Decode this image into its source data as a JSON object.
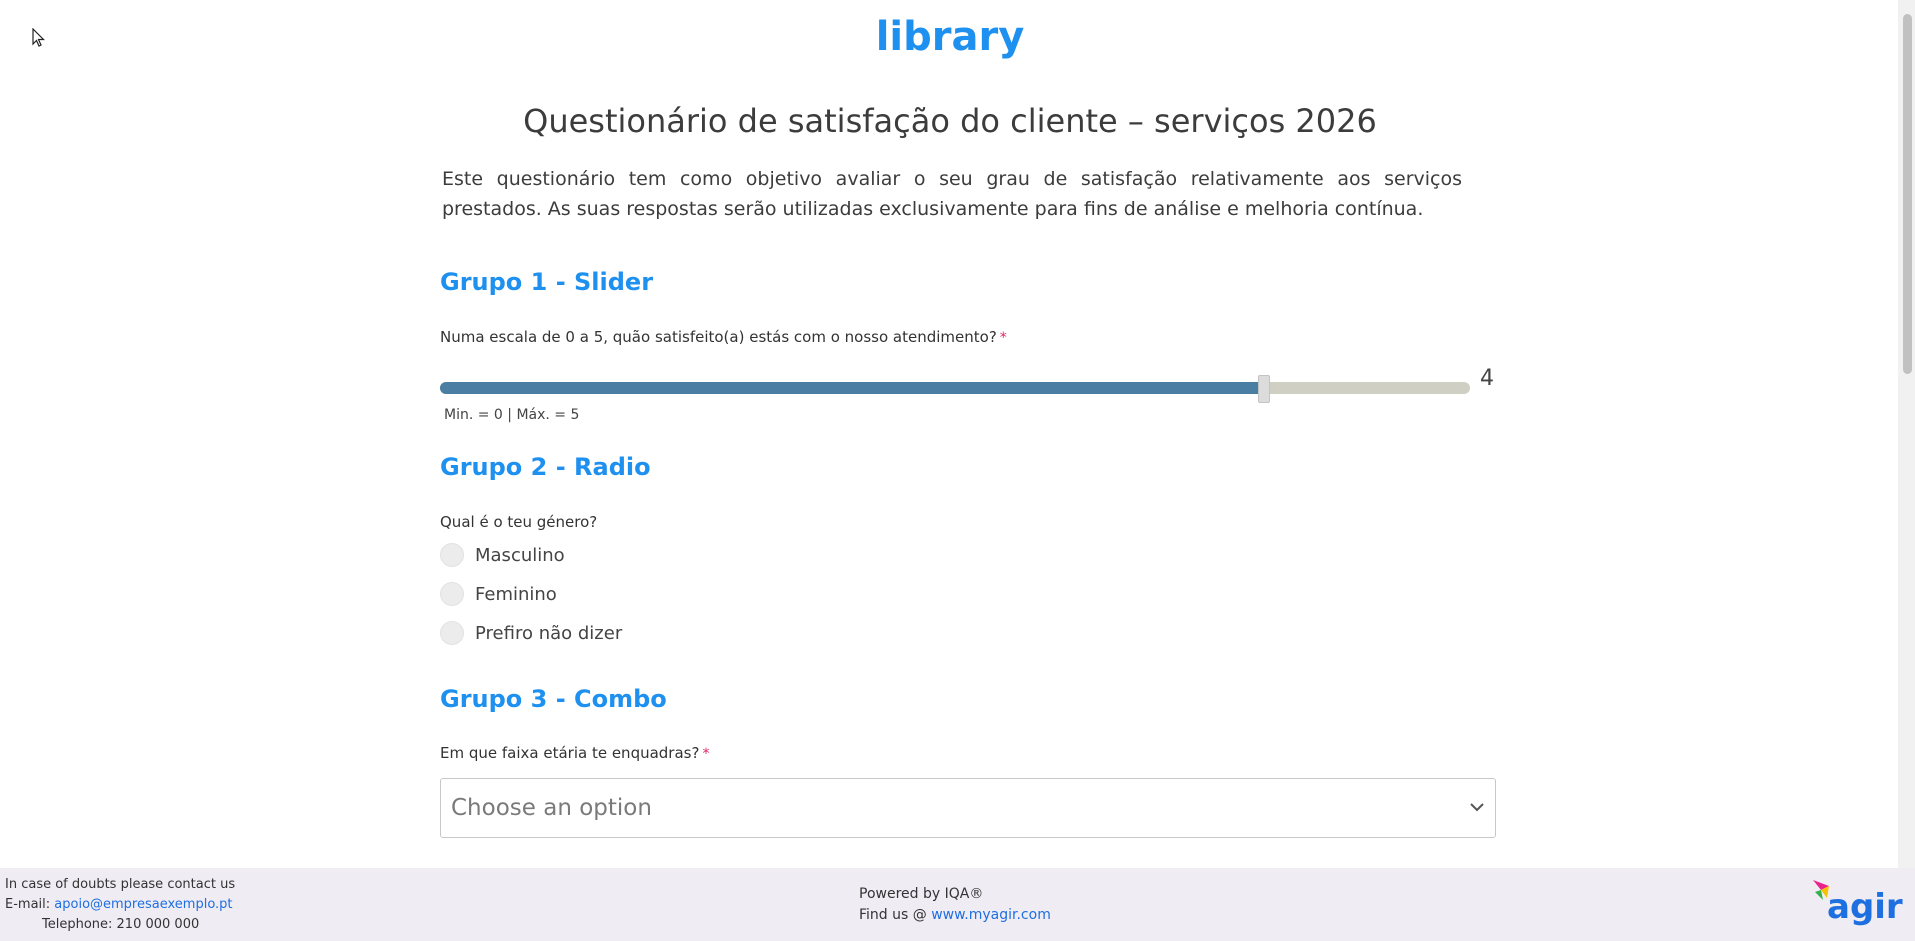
{
  "header": {
    "logo": "library"
  },
  "page": {
    "title": "Questionário de satisfação do cliente – serviços 2026",
    "intro": "Este questionário tem como objetivo avaliar o seu grau de satisfação relativamente aos serviços prestados. As suas respostas serão utilizadas exclusivamente para fins de análise e melhoria contínua."
  },
  "group1": {
    "title": "Grupo 1 - Slider",
    "question": "Numa escala de 0 a 5, quão satisfeito(a) estás com o nosso atendimento?",
    "required_mark": "*",
    "slider": {
      "min": 0,
      "max": 5,
      "value": 4,
      "value_label": "4",
      "hint": "Min. = 0 | Máx. = 5"
    }
  },
  "group2": {
    "title": "Grupo 2 - Radio",
    "question": "Qual é o teu género?",
    "options": [
      {
        "label": "Masculino",
        "checked": false
      },
      {
        "label": "Feminino",
        "checked": false
      },
      {
        "label": "Prefiro não dizer",
        "checked": false
      }
    ]
  },
  "group3": {
    "title": "Grupo 3 - Combo",
    "question": "Em que faixa etária te enquadras?",
    "required_mark": "*",
    "combo": {
      "placeholder": "Choose an option"
    }
  },
  "footer": {
    "contact_heading": "In case of doubts please contact us",
    "email_label": "E-mail:",
    "email": "apoio@empresaexemplo.pt",
    "telephone": "Telephone: 210 000 000",
    "powered_by": "Powered by IQA®",
    "find_us_label": "Find us @",
    "website": "www.myagir.com",
    "brand_logo": "agir"
  },
  "colors": {
    "accent": "#1e90ef",
    "slider_fill": "#4a7fa3",
    "slider_track": "#cfcfc4",
    "required": "#e0245e",
    "footer_bg": "#f0ecf4"
  }
}
